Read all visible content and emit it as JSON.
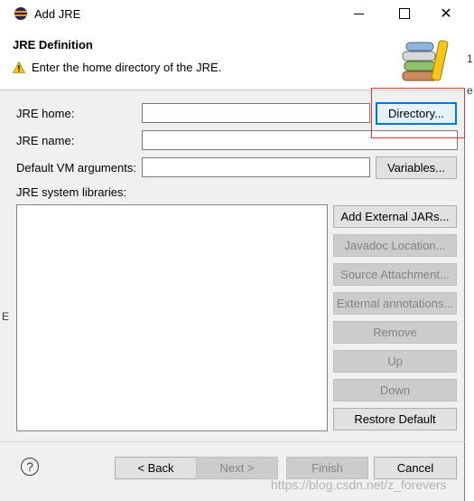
{
  "window": {
    "title": "Add JRE"
  },
  "header": {
    "title": "JRE Definition",
    "message": "Enter the home directory of the JRE."
  },
  "form": {
    "jre_home": {
      "label": "JRE home:",
      "value": ""
    },
    "jre_name": {
      "label": "JRE name:",
      "value": ""
    },
    "vm_args": {
      "label": "Default VM arguments:",
      "value": ""
    },
    "libraries_label": "JRE system libraries:"
  },
  "buttons": {
    "directory": "Directory...",
    "variables": "Variables...",
    "add_external_jars": "Add External JARs...",
    "javadoc_location": "Javadoc Location...",
    "source_attachment": "Source Attachment...",
    "external_annotations": "External annotations...",
    "remove": "Remove",
    "up": "Up",
    "down": "Down",
    "restore_default": "Restore Default"
  },
  "footer": {
    "help": "?",
    "back": "< Back",
    "next": "Next >",
    "finish": "Finish",
    "cancel": "Cancel"
  },
  "background_fragments": {
    "right_top": "1",
    "right_mid": "e",
    "left_mid": "E"
  },
  "watermark": "https://blog.csdn.net/z_forevers",
  "colors": {
    "accent": "#0078d7",
    "highlight_box": "#e63232"
  }
}
